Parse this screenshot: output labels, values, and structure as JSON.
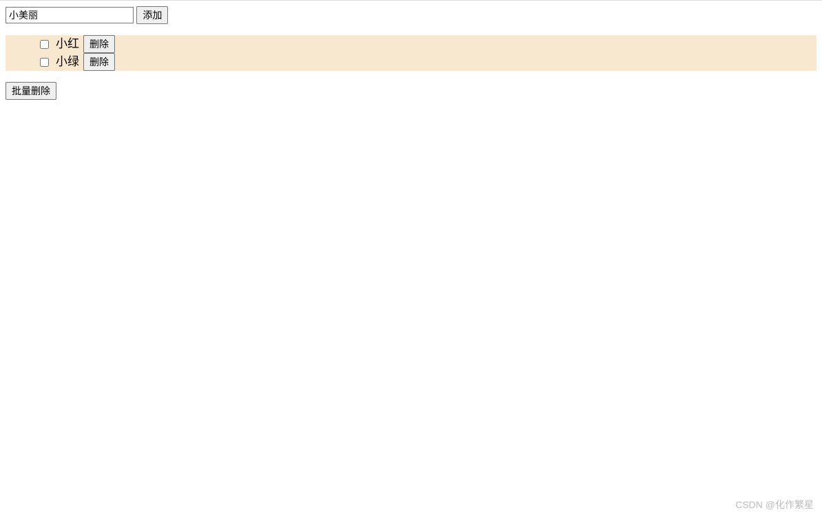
{
  "input": {
    "value": "小美丽",
    "add_label": "添加"
  },
  "items": [
    {
      "name": "小红",
      "delete_label": "删除",
      "checked": false
    },
    {
      "name": "小绿",
      "delete_label": "删除",
      "checked": false
    }
  ],
  "bulk_delete_label": "批量删除",
  "watermark": "CSDN @化作繁星"
}
